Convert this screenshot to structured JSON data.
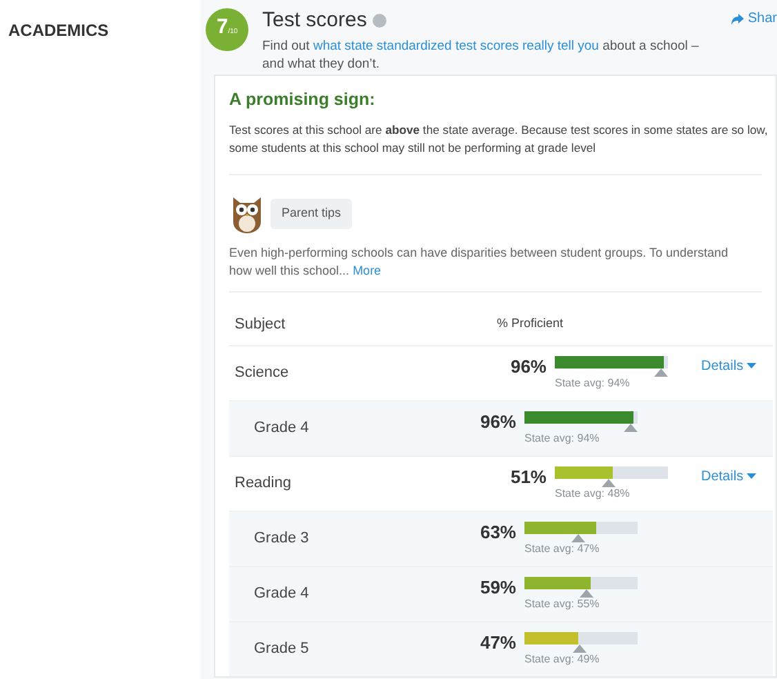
{
  "sidebar": {
    "heading": "ACADEMICS"
  },
  "header": {
    "score": "7",
    "score_scale": "/10",
    "title": "Test scores",
    "intro_before": "Find out ",
    "intro_link": "what state standardized test scores really tell you",
    "intro_after": " about a school – and what they don’t.",
    "share": "Shar"
  },
  "summary": {
    "heading": "A promising sign:",
    "text": "Test scores at this school are **above** the state average. Because test scores in some states are so low, some students at this school may still not be performing at grade level"
  },
  "tips": {
    "label": "Parent tips",
    "text": "Even high-performing schools can have disparities between student groups. To understand how well this school...",
    "more": "More"
  },
  "table": {
    "columns": [
      "Subject",
      "% Proficient"
    ],
    "rows": [
      {
        "kind": "subject",
        "label": "Science",
        "percent": "96%",
        "bar": {
          "level": 0.96,
          "color": "#3b8b2e"
        },
        "marker": {
          "level": 0.94
        },
        "state_avg": "State avg: 94%",
        "details": "Details"
      },
      {
        "kind": "grade",
        "label": "Grade 4",
        "percent": "96%",
        "bar": {
          "level": 0.96,
          "color": "#3b8b2e"
        },
        "marker": {
          "level": 0.94
        },
        "state_avg": "State avg: 94%"
      },
      {
        "kind": "subject",
        "label": "Reading",
        "percent": "51%",
        "bar": {
          "level": 0.51,
          "color": "#a8c12c"
        },
        "marker": {
          "level": 0.48
        },
        "state_avg": "State avg: 48%",
        "details": "Details"
      },
      {
        "kind": "grade",
        "label": "Grade 3",
        "percent": "63%",
        "bar": {
          "level": 0.63,
          "color": "#8fb42e"
        },
        "marker": {
          "level": 0.47
        },
        "state_avg": "State avg: 47%"
      },
      {
        "kind": "grade",
        "label": "Grade 4",
        "percent": "59%",
        "bar": {
          "level": 0.59,
          "color": "#8fb42e"
        },
        "marker": {
          "level": 0.55
        },
        "state_avg": "State avg: 55%"
      },
      {
        "kind": "grade",
        "label": "Grade 5",
        "percent": "47%",
        "bar": {
          "level": 0.47,
          "color": "#c2c02c"
        },
        "marker": {
          "level": 0.49
        },
        "state_avg": "State avg: 49%"
      }
    ]
  }
}
